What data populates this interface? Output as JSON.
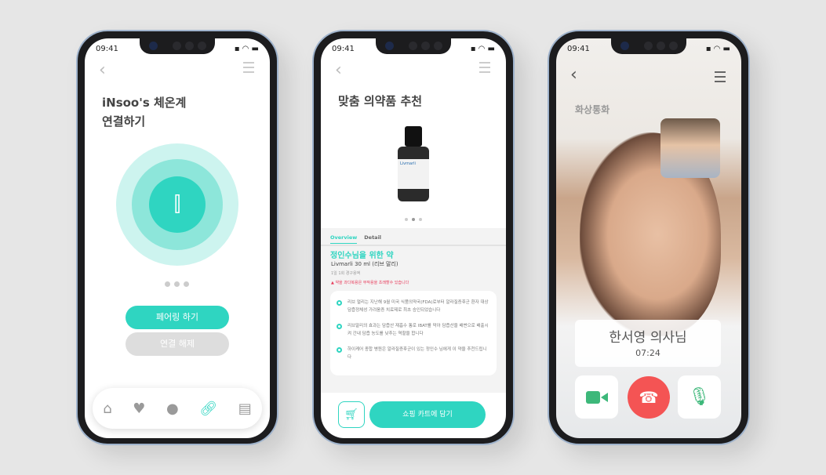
{
  "status": {
    "time": "09:41"
  },
  "colors": {
    "accent": "#2fd5c1",
    "end_call": "#f45454",
    "call_icons": "#3db87a"
  },
  "phone1": {
    "title_line1": "iNsoo's 체온계",
    "title_line2": "연결하기",
    "pair_button": "페어링 하기",
    "disconnect_button": "연결 해제",
    "tabs": [
      "home-icon",
      "heart-icon",
      "pills-icon",
      "link-icon",
      "document-icon"
    ],
    "active_tab": "link-icon"
  },
  "phone2": {
    "title": "맞춤 의약품 추천",
    "tabs": [
      "Overview",
      "Detail"
    ],
    "heading": "정인수님을 위한 약",
    "product": "Livmarli 30 ml (리브 말리)",
    "dosage": "1일 1회 경구용액",
    "warning": "약을 과다복용은 부작용을 초래할수 있습니다",
    "bullets": [
      "리브 멀리는 지난해 9월 미국 식품의약국(FDA)로부터 알라질증후군 환자 대상 담즙정체성 가려움증 치료제로 최초 승인되었습니다",
      "리브말리의 효과는 담즙산 재흡수 통로 IBAT를 막아 담즙산을 배변으로 배출시켜 간내 담즙 농도를 낮추는 역할을 합니다",
      "하이케어 종합 병원은 알라질증후군이 있는 정인수 님에게 이 약을 추천드립니다"
    ],
    "cart_button": "쇼핑 카트에 담기",
    "bottle_label": "Livmarli"
  },
  "phone3": {
    "title": "화상통화",
    "doctor": "한서영 의사님",
    "duration": "07:24"
  }
}
